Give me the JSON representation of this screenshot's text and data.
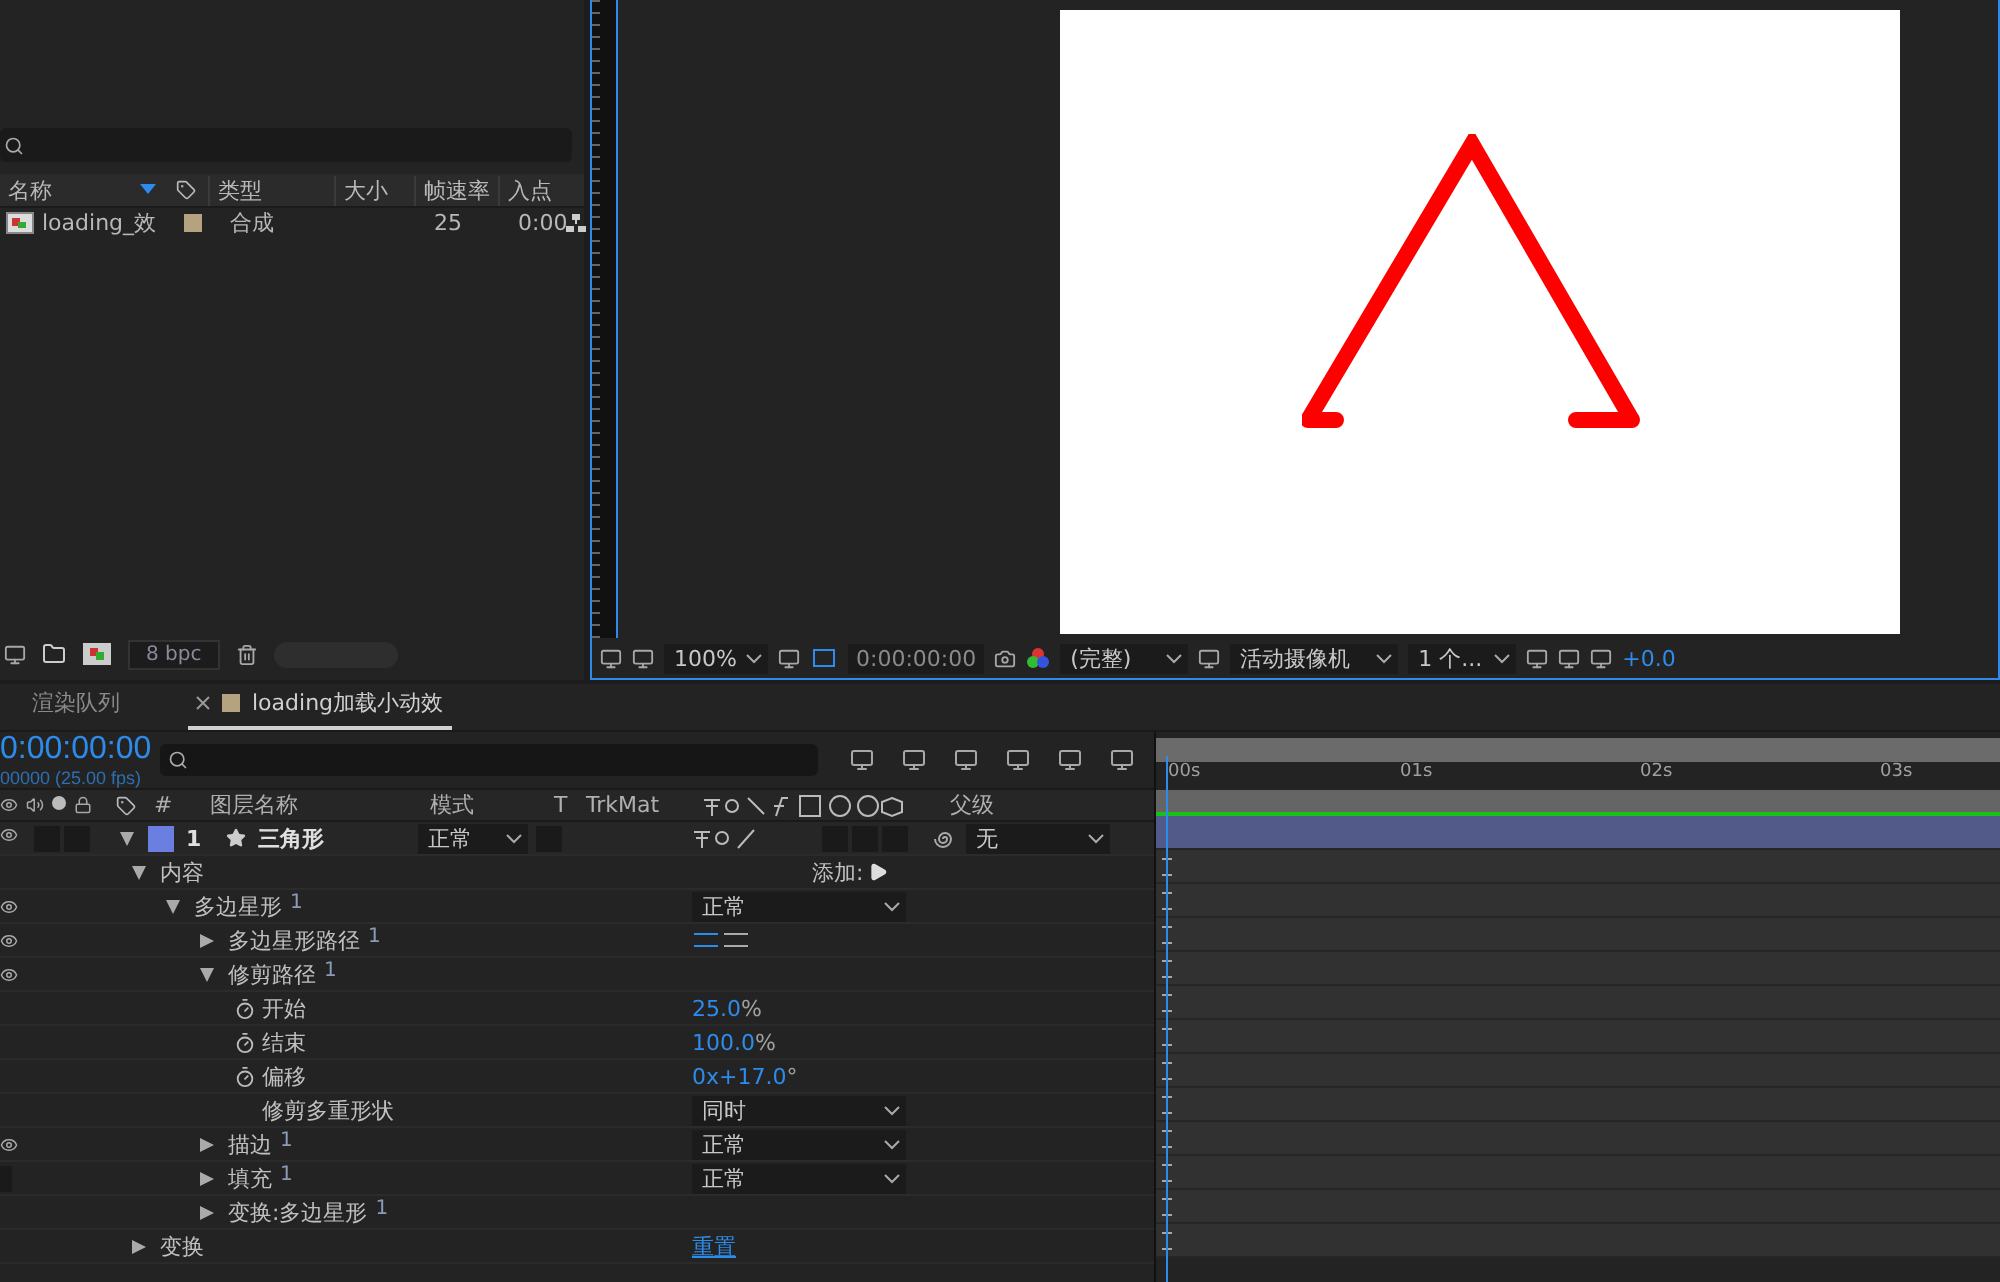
{
  "project": {
    "columns": [
      "名称",
      "类型",
      "大小",
      "帧速率",
      "入点"
    ],
    "items": [
      {
        "name": "loading_效",
        "type": "合成",
        "frame_rate": "25",
        "in_point": "0:00",
        "color": "#b5a27e"
      }
    ],
    "bit_depth": "8 bpc"
  },
  "viewer": {
    "zoom": "100%",
    "timecode": "0:00:00:00",
    "resolution": "(完整)",
    "camera": "活动摄像机",
    "views": "1 个...",
    "exposure": "+0.0"
  },
  "timeline": {
    "tabs": [
      {
        "label": "渲染队列",
        "selected": false,
        "closable": false
      },
      {
        "label": "loading加载小动效",
        "selected": true,
        "closable": true
      }
    ],
    "timecode": "0:00:00:00",
    "fps": "00000 (25.00 fps)",
    "columns": [
      "#",
      "图层名称",
      "模式",
      "T",
      "TrkMat",
      "父级"
    ],
    "ruler": [
      "00s",
      "01s",
      "02s",
      "03s"
    ],
    "layer": {
      "number": "1",
      "name": "三角形",
      "mode": "正常",
      "parent": "无",
      "color": "#6b7fe0",
      "expanded": true
    },
    "properties": [
      {
        "label": "内容",
        "expanded": true,
        "control": {
          "kind": "add",
          "label": "添加:"
        },
        "children": [
          {
            "label": "多边星形",
            "index": "1",
            "expanded": true,
            "visible": true,
            "control": {
              "kind": "dropdown",
              "value": "正常"
            },
            "children": [
              {
                "label": "多边星形路径",
                "index": "1",
                "expanded": false,
                "visible": true,
                "control": {
                  "kind": "direction"
                }
              },
              {
                "label": "修剪路径",
                "index": "1",
                "expanded": true,
                "visible": true,
                "children": [
                  {
                    "label": "开始",
                    "stopwatch": true,
                    "control": {
                      "kind": "number",
                      "value": "25.0",
                      "unit": "%"
                    }
                  },
                  {
                    "label": "结束",
                    "stopwatch": true,
                    "control": {
                      "kind": "number",
                      "value": "100.0",
                      "unit": "%"
                    }
                  },
                  {
                    "label": "偏移",
                    "stopwatch": true,
                    "control": {
                      "kind": "number",
                      "value": "0x+17.0",
                      "unit": "°"
                    }
                  },
                  {
                    "label": "修剪多重形状",
                    "stopwatch": false,
                    "control": {
                      "kind": "dropdown",
                      "value": "同时"
                    }
                  }
                ]
              },
              {
                "label": "描边",
                "index": "1",
                "expanded": false,
                "visible": true,
                "control": {
                  "kind": "dropdown",
                  "value": "正常"
                }
              },
              {
                "label": "填充",
                "index": "1",
                "expanded": false,
                "visible": false,
                "control": {
                  "kind": "dropdown",
                  "value": "正常"
                }
              },
              {
                "label": "变换:多边星形",
                "index": "1",
                "expanded": false
              }
            ]
          }
        ]
      },
      {
        "label": "变换",
        "expanded": false,
        "control": {
          "kind": "link",
          "value": "重置"
        }
      }
    ]
  }
}
